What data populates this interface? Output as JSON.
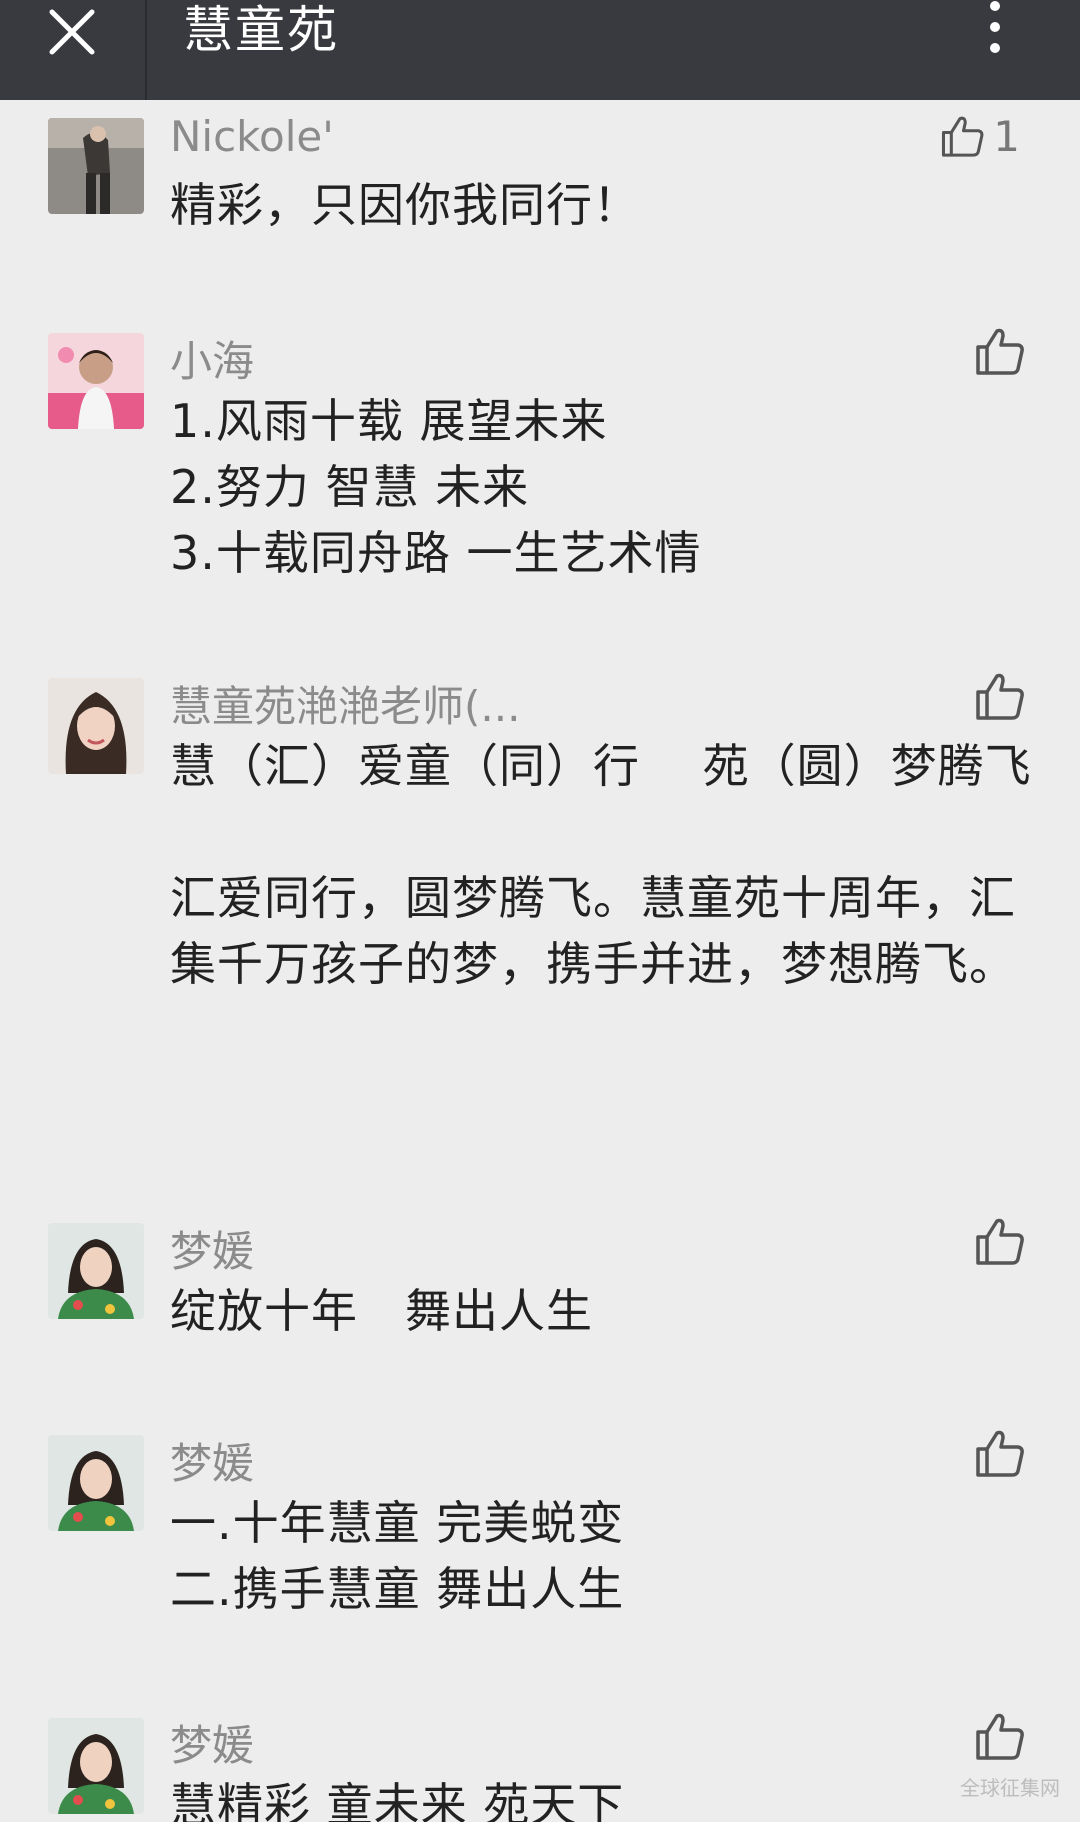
{
  "header": {
    "title": "慧童苑",
    "close_icon": "close-icon",
    "more_icon": "more-vertical-icon"
  },
  "comments": [
    {
      "name": "Nickole'",
      "text": "精彩，只因你我同行！",
      "likes": "1",
      "avatar_icon": "avatar-photo"
    },
    {
      "name": "小海",
      "text": "1.风雨十载 展望未来\n2.努力 智慧 未来\n3.十载同舟路 一生艺术情",
      "likes": "",
      "avatar_icon": "avatar-photo"
    },
    {
      "name": "慧童苑滟滟老师(...",
      "text": "慧（汇）爱童（同）行　 苑（圆）梦腾飞\n\n汇爱同行，圆梦腾飞。慧童苑十周年，汇集千万孩子的梦，携手并进，梦想腾飞。",
      "likes": "",
      "avatar_icon": "avatar-photo"
    },
    {
      "name": "梦媛",
      "text": "绽放十年　舞出人生",
      "likes": "",
      "avatar_icon": "avatar-photo"
    },
    {
      "name": "梦媛",
      "text": "一.十年慧童 完美蜕变\n二.携手慧童 舞出人生",
      "likes": "",
      "avatar_icon": "avatar-photo"
    },
    {
      "name": "梦媛",
      "text": "慧精彩 童未来 苑天下",
      "likes": "",
      "avatar_icon": "avatar-photo"
    }
  ],
  "watermark": "全球征集网",
  "colors": {
    "topbar": "#393a3f",
    "background": "#ededed",
    "name": "#8b8b8b",
    "text": "#222222"
  }
}
